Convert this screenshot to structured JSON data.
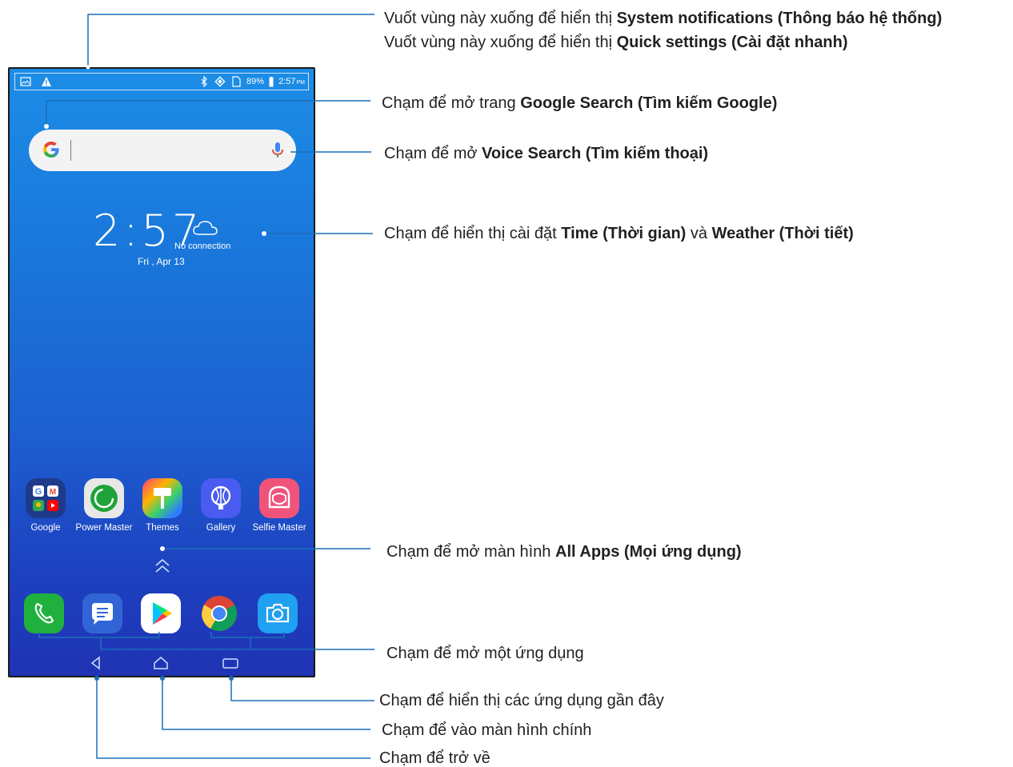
{
  "status_bar": {
    "battery_percent": "89%",
    "time": "2:57",
    "ampm": "PM",
    "icons": [
      "gallery-icon",
      "warning-icon",
      "bluetooth-icon",
      "vibrate-icon",
      "sim-icon",
      "battery-icon"
    ]
  },
  "search_bar": {
    "logo": "google-g-icon",
    "mic": "microphone-icon"
  },
  "clock_widget": {
    "time": "2:57",
    "weather_status": "No connection",
    "date": "Fri , Apr 13",
    "weather_icon": "cloud-icon"
  },
  "home_apps": [
    {
      "label": "Google",
      "icon": "google-folder-icon"
    },
    {
      "label": "Power Master",
      "icon": "power-master-icon"
    },
    {
      "label": "Themes",
      "icon": "themes-icon"
    },
    {
      "label": "Gallery",
      "icon": "gallery-app-icon"
    },
    {
      "label": "Selfie Master",
      "icon": "selfie-master-icon"
    }
  ],
  "dock_apps": [
    "phone-icon",
    "messages-icon",
    "play-store-icon",
    "chrome-icon",
    "camera-icon"
  ],
  "nav_buttons": [
    "back-icon",
    "home-icon",
    "recents-icon"
  ],
  "callouts": {
    "notifications": {
      "pre": "Vuốt vùng này xuống để hiển thị ",
      "bold": "System notifications (Thông báo hệ thống)"
    },
    "quick_settings": {
      "pre": "Vuốt vùng này xuống để hiển thị ",
      "bold": "Quick settings (Cài đặt nhanh)"
    },
    "google_search": {
      "pre": "Chạm để mở trang ",
      "bold": "Google Search (Tìm kiếm Google)"
    },
    "voice_search": {
      "pre": "Chạm để mở ",
      "bold": "Voice Search (Tìm kiếm thoại)"
    },
    "time_weather": {
      "pre": "Chạm để hiển thị cài đặt ",
      "bold1": "Time (Thời gian)",
      "mid": " và ",
      "bold2": "Weather (Thời tiết)"
    },
    "all_apps": {
      "pre": "Chạm để mở màn hình ",
      "bold": "All Apps (Mọi ứng dụng)"
    },
    "open_app": "Chạm để mở một ứng dụng",
    "recent_apps": "Chạm để hiển thị các ứng dụng gần đây",
    "home_screen": "Chạm để vào màn hình chính",
    "back": "Chạm để trở về"
  }
}
